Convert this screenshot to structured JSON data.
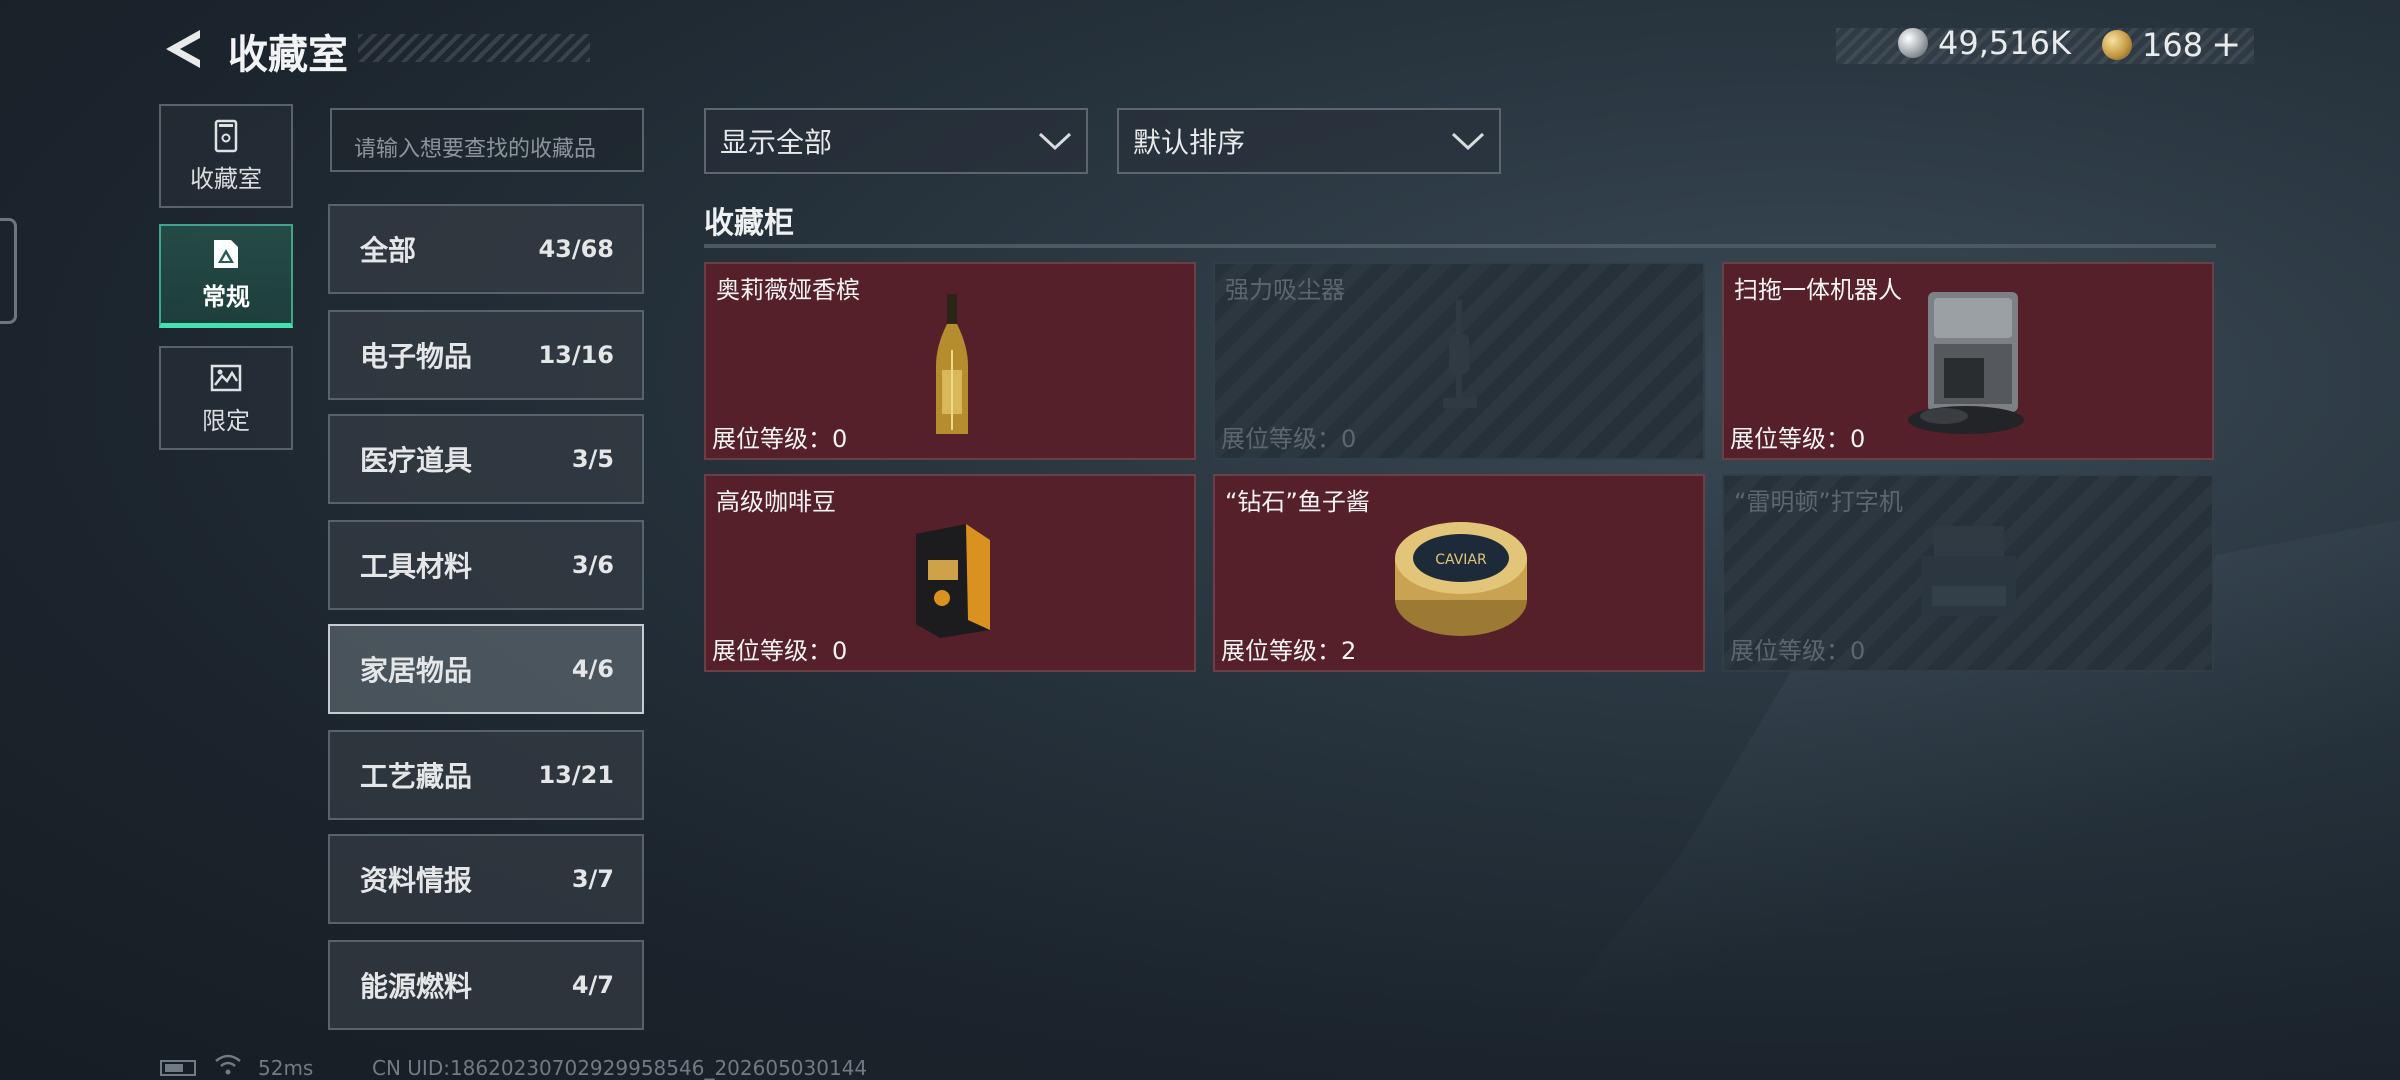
{
  "header": {
    "title": "收藏室"
  },
  "currency": {
    "silver_amount": "49,516K",
    "gold_amount": "168",
    "add_symbol": "+"
  },
  "left_nav": [
    {
      "label": "收藏室",
      "icon": "collection-room-icon",
      "active": false
    },
    {
      "label": "常规",
      "icon": "regular-icon",
      "active": true
    },
    {
      "label": "限定",
      "icon": "limited-icon",
      "active": false
    }
  ],
  "search": {
    "placeholder": "请输入想要查找的收藏品"
  },
  "categories": [
    {
      "name": "全部",
      "count": "43/68"
    },
    {
      "name": "电子物品",
      "count": "13/16"
    },
    {
      "name": "医疗道具",
      "count": "3/5"
    },
    {
      "name": "工具材料",
      "count": "3/6"
    },
    {
      "name": "家居物品",
      "count": "4/6",
      "selected": true
    },
    {
      "name": "工艺藏品",
      "count": "13/21"
    },
    {
      "name": "资料情报",
      "count": "3/7"
    },
    {
      "name": "能源燃料",
      "count": "4/7"
    }
  ],
  "filters": {
    "display": "显示全部",
    "sort": "默认排序"
  },
  "cabinet": {
    "title": "收藏柜",
    "level_label": "展位等级：",
    "items": [
      {
        "name": "奥莉薇娅香槟",
        "level": "0",
        "owned": true,
        "icon": "champagne-bottle-icon"
      },
      {
        "name": "强力吸尘器",
        "level": "0",
        "owned": false,
        "icon": "vacuum-cleaner-icon"
      },
      {
        "name": "扫拖一体机器人",
        "level": "0",
        "owned": true,
        "icon": "robot-mop-icon"
      },
      {
        "name": "高级咖啡豆",
        "level": "0",
        "owned": true,
        "icon": "coffee-bag-icon"
      },
      {
        "name": "“钻石”鱼子酱",
        "level": "2",
        "owned": true,
        "icon": "caviar-tin-icon",
        "tin_label": "CAVIAR"
      },
      {
        "name": "“雷明顿”打字机",
        "level": "0",
        "owned": false,
        "icon": "typewriter-icon"
      }
    ]
  },
  "status_bar": {
    "latency": "52ms",
    "uid": "CN UID:1862023070292995854​6_202605030144"
  },
  "colors": {
    "accent": "#47e0b0",
    "owned_card": "#552029",
    "locked_card": "#26313a"
  }
}
